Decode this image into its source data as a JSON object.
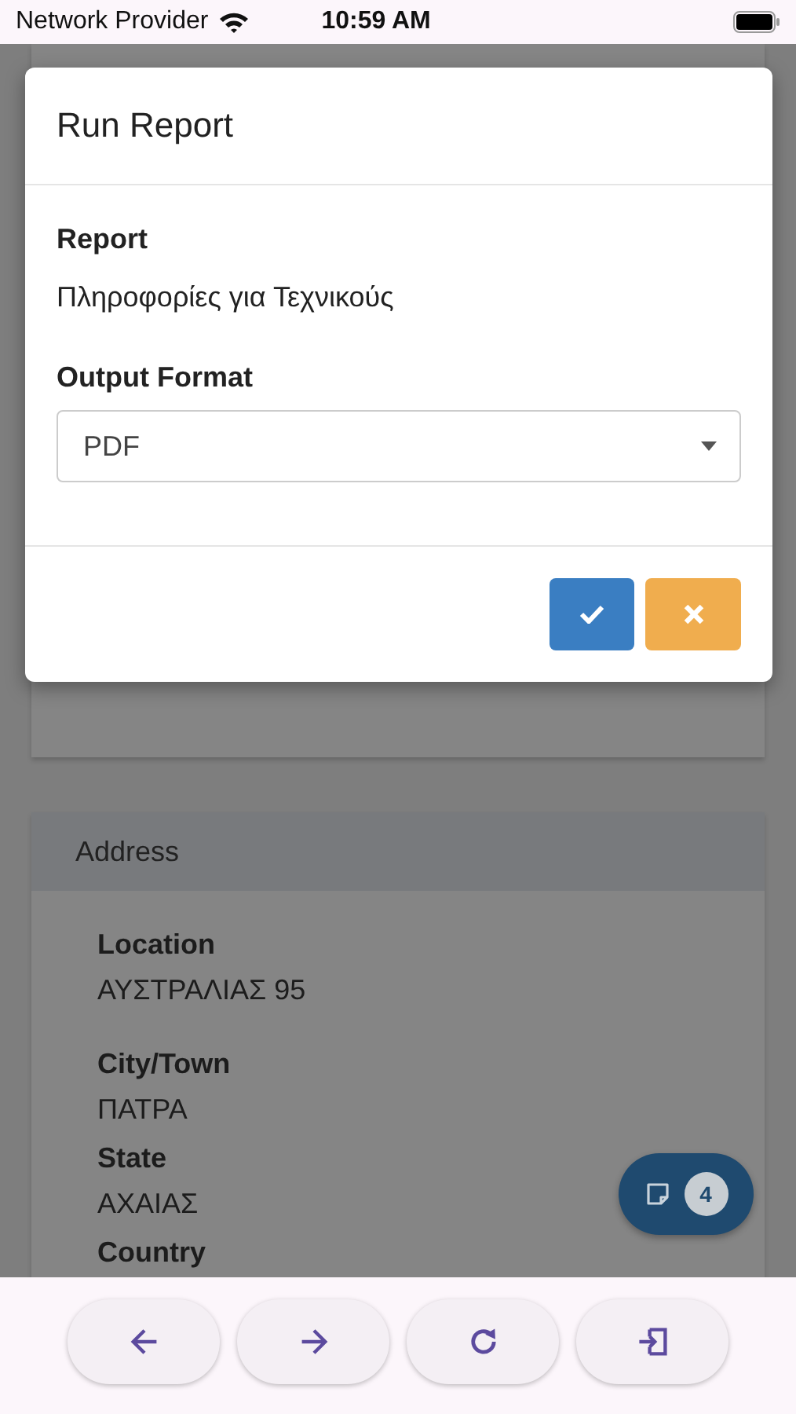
{
  "status_bar": {
    "carrier": "Network Provider",
    "time": "10:59 AM"
  },
  "dialog": {
    "title": "Run Report",
    "fields": [
      {
        "kind": "text",
        "label": "Report",
        "value": "Πληροφορίες για Τεχνικούς"
      },
      {
        "kind": "select",
        "label": "Output Format",
        "value": "PDF"
      }
    ],
    "buttons": [
      {
        "kind": "confirm"
      },
      {
        "kind": "cancel"
      }
    ]
  },
  "address": {
    "title": "Address",
    "fields": [
      {
        "label": "Location",
        "value": "ΑΥΣΤΡΑΛΙΑΣ 95"
      },
      {
        "label": "City/Town",
        "value": "ΠΑΤΡΑ"
      },
      {
        "label": "State",
        "value": "ΑΧΑΙΑΣ"
      },
      {
        "label": "Country"
      }
    ]
  },
  "notes_button": {
    "count": "4"
  },
  "bottom_bar": {
    "buttons": [
      {
        "kind": "back"
      },
      {
        "kind": "forward"
      },
      {
        "kind": "refresh"
      },
      {
        "kind": "exit"
      }
    ]
  }
}
